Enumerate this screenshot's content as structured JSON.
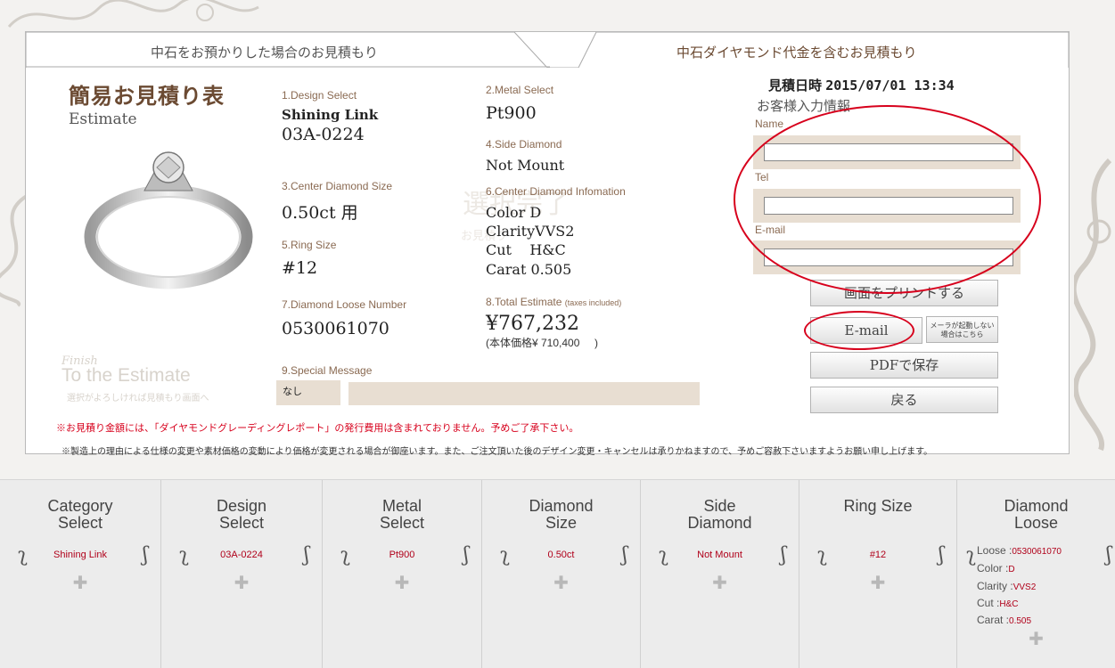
{
  "tabs": {
    "left": "中石をお預かりした場合のお見積もり",
    "right": "中石ダイヤモンド代金を含むお見積もり"
  },
  "header": {
    "title_jp": "簡易お見積り表",
    "title_en": "Estimate",
    "date_label": "見積日時",
    "date_value": "2015/07/01 13:34"
  },
  "fields": {
    "design_select": {
      "label": "1.Design Select",
      "line1": "Shining Link",
      "line2": "03A-0224"
    },
    "metal_select": {
      "label": "2.Metal Select",
      "value": "Pt900"
    },
    "center_size": {
      "label": "3.Center Diamond Size",
      "value": "0.50ct 用"
    },
    "side_diamond": {
      "label": "4.Side Diamond",
      "value": "Not Mount"
    },
    "ring_size": {
      "label": "5.Ring Size",
      "value": "#12"
    },
    "center_info": {
      "label": "6.Center Diamond Infomation",
      "color": "Color D",
      "clarity": "ClarityVVS2",
      "cut": "Cut    H&C",
      "carat": "Carat 0.505"
    },
    "loose_number": {
      "label": "7.Diamond Loose Number",
      "value": "0530061070"
    },
    "total_estimate": {
      "label": "8.Total Estimate",
      "label_note": "(taxes included)",
      "value": "¥767,232",
      "note": "(本体価格¥ 710,400     )"
    },
    "special_message": {
      "label": "9.Special Message",
      "value": "なし"
    }
  },
  "finish": {
    "small": "Finish",
    "big": "To the Estimate",
    "caption": "選択がよろしければ見積もり画面へ"
  },
  "watermark": {
    "main": "選択完了",
    "sub": "お見積り"
  },
  "customer": {
    "title": "お客様入力情報",
    "name_label": "Name",
    "tel_label": "Tel",
    "email_label": "E-mail",
    "name_value": "",
    "tel_value": "",
    "email_value": ""
  },
  "buttons": {
    "print": "画面をプリントする",
    "email": "E-mail",
    "mailer_note_1": "メーラが起動しない",
    "mailer_note_2": "場合はこちら",
    "pdf": "PDFで保存",
    "back": "戻る"
  },
  "notes": {
    "red": "※お見積り金額には、「ダイヤモンドグレーディングレポート」の発行費用は含まれておりません。予めご了承下さい。",
    "grey": "※製造上の理由による仕様の変更や素材価格の変動により価格が変更される場合が御座います。また、ご注文頂いた後のデザイン変更・キャンセルは承りかねますので、予めご容赦下さいますようお願い申し上げます。"
  },
  "nav": [
    {
      "title1": "Category",
      "title2": "Select",
      "value": "Shining Link"
    },
    {
      "title1": "Design",
      "title2": "Select",
      "value": "03A-0224"
    },
    {
      "title1": "Metal",
      "title2": "Select",
      "value": "Pt900"
    },
    {
      "title1": "Diamond",
      "title2": "Size",
      "value": "0.50ct"
    },
    {
      "title1": "Side",
      "title2": "Diamond",
      "value": "Not Mount"
    },
    {
      "title1": "Ring Size",
      "title2": "",
      "value": "#12"
    },
    {
      "title1": "Diamond",
      "title2": "Loose",
      "loose_label": "Loose",
      "loose_value": "0530061070",
      "color_label": "Color",
      "color_value": "D",
      "clarity_label": "Clarity",
      "clarity_value": "VVS2",
      "cut_label": "Cut",
      "cut_value": "H&C",
      "carat_label": "Carat",
      "carat_value": "0.505"
    }
  ],
  "colors": {
    "accent_brown": "#6b4a32",
    "highlight_red": "#d7001c",
    "field_beige": "#e8ded2"
  }
}
